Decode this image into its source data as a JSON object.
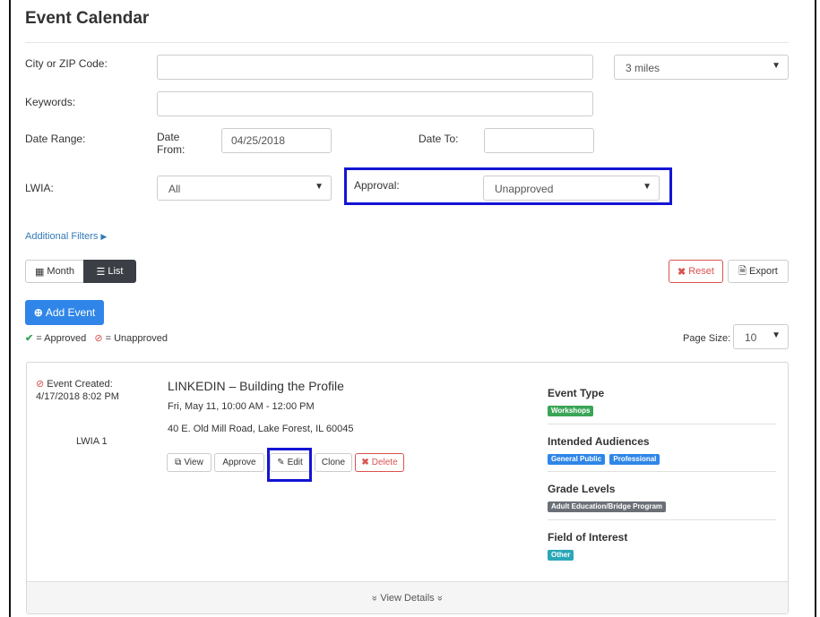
{
  "page": {
    "title": "Event Calendar"
  },
  "filters": {
    "city_label": "City or ZIP Code:",
    "city_value": "",
    "radius_value": "3 miles",
    "keywords_label": "Keywords:",
    "keywords_value": "",
    "date_range_label": "Date Range:",
    "date_from_label": "Date From:",
    "date_from_value": "04/25/2018",
    "date_to_label": "Date To:",
    "date_to_value": "",
    "lwia_label": "LWIA:",
    "lwia_value": "All",
    "approval_label": "Approval:",
    "approval_value": "Unapproved",
    "additional_filters": "Additional Filters"
  },
  "toolbar": {
    "month_label": "Month",
    "list_label": "List",
    "reset_label": "Reset",
    "export_label": "Export",
    "add_event_label": "Add Event"
  },
  "legend": {
    "approved": "= Approved",
    "unapproved": "= Unapproved"
  },
  "pagination": {
    "page_size_label": "Page Size:",
    "page_size_value": "10"
  },
  "event": {
    "created_label": "Event Created:",
    "created_at": "4/17/2018 8:02 PM",
    "lwia": "LWIA 1",
    "title": "LINKEDIN – Building the Profile",
    "datetime": "Fri, May 11, 10:00 AM - 12:00 PM",
    "address": "40 E. Old Mill Road, Lake Forest, IL 60045",
    "actions": {
      "view": "View",
      "approve": "Approve",
      "edit": "Edit",
      "clone": "Clone",
      "delete": "Delete"
    },
    "event_type_title": "Event Type",
    "event_type": "Workshops",
    "audiences_title": "Intended Audiences",
    "audiences": [
      "General Public",
      "Professional"
    ],
    "grade_levels_title": "Grade Levels",
    "grade_level": "Adult Education/Bridge Program",
    "field_title": "Field of Interest",
    "field": "Other",
    "view_details": "View Details"
  },
  "colors": {
    "accent": "#2f86e8",
    "highlight": "#1414d4",
    "approved": "#3aa556",
    "unapproved": "#d9534f"
  }
}
